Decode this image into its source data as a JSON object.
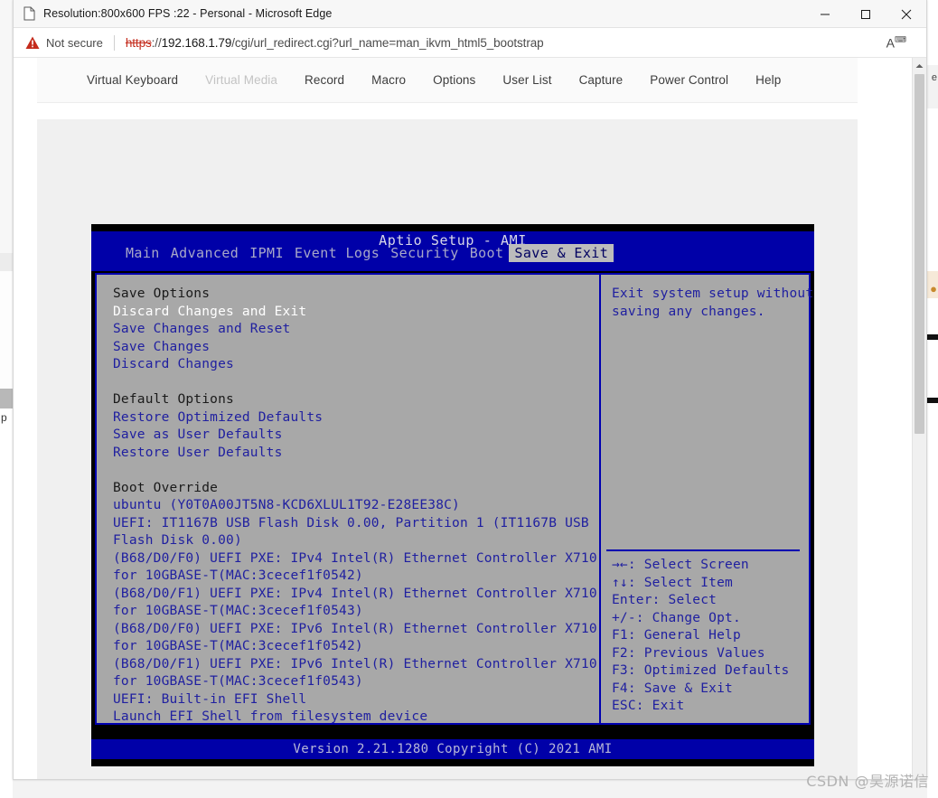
{
  "window": {
    "title": "Resolution:800x600 FPS :22 - Personal - Microsoft Edge",
    "tab_icon": "document-icon",
    "minimize_label": "—",
    "maximize_label": "☐",
    "close_label": "✕"
  },
  "address_bar": {
    "security_icon": "warning-triangle-icon",
    "security_label": "Not secure",
    "url_scheme": "https",
    "url_separator": "://",
    "url_host": "192.168.1.79",
    "url_path": "/cgi/url_redirect.cgi?url_name=man_ikvm_html5_bootstrap",
    "read_aloud_icon": "read-aloud-icon"
  },
  "kvm_toolbar": {
    "items": [
      {
        "label": "Virtual Keyboard",
        "disabled": false
      },
      {
        "label": "Virtual Media",
        "disabled": true
      },
      {
        "label": "Record",
        "disabled": false
      },
      {
        "label": "Macro",
        "disabled": false
      },
      {
        "label": "Options",
        "disabled": false
      },
      {
        "label": "User List",
        "disabled": false
      },
      {
        "label": "Capture",
        "disabled": false
      },
      {
        "label": "Power Control",
        "disabled": false
      },
      {
        "label": "Help",
        "disabled": false
      }
    ]
  },
  "bios": {
    "title": "Aptio Setup - AMI",
    "tabs": [
      {
        "label": "Main",
        "active": false
      },
      {
        "label": "Advanced",
        "active": false
      },
      {
        "label": "IPMI",
        "active": false
      },
      {
        "label": "Event Logs",
        "active": false
      },
      {
        "label": "Security",
        "active": false
      },
      {
        "label": "Boot",
        "active": false
      },
      {
        "label": "Save & Exit",
        "active": true
      }
    ],
    "left_lines": [
      {
        "text": "Save Options",
        "style": "head"
      },
      {
        "text": "Discard Changes and Exit",
        "style": "sel"
      },
      {
        "text": "Save Changes and Reset",
        "style": "item"
      },
      {
        "text": "Save Changes",
        "style": "item"
      },
      {
        "text": "Discard Changes",
        "style": "item"
      },
      {
        "text": " ",
        "style": "blank"
      },
      {
        "text": "Default Options",
        "style": "head"
      },
      {
        "text": "Restore Optimized Defaults",
        "style": "item"
      },
      {
        "text": "Save as User Defaults",
        "style": "item"
      },
      {
        "text": "Restore User Defaults",
        "style": "item"
      },
      {
        "text": " ",
        "style": "blank"
      },
      {
        "text": "Boot Override",
        "style": "head"
      },
      {
        "text": "ubuntu (Y0T0A00JT5N8-KCD6XLUL1T92-E28EE38C)",
        "style": "item"
      },
      {
        "text": "UEFI: IT1167B USB Flash Disk 0.00, Partition 1 (IT1167B USB",
        "style": "item"
      },
      {
        "text": "Flash Disk 0.00)",
        "style": "item"
      },
      {
        "text": "(B68/D0/F0) UEFI PXE: IPv4 Intel(R) Ethernet Controller X710",
        "style": "item"
      },
      {
        "text": "for 10GBASE-T(MAC:3cecef1f0542)",
        "style": "item"
      },
      {
        "text": "(B68/D0/F1) UEFI PXE: IPv4 Intel(R) Ethernet Controller X710",
        "style": "item"
      },
      {
        "text": "for 10GBASE-T(MAC:3cecef1f0543)",
        "style": "item"
      },
      {
        "text": "(B68/D0/F0) UEFI PXE: IPv6 Intel(R) Ethernet Controller X710",
        "style": "item"
      },
      {
        "text": "for 10GBASE-T(MAC:3cecef1f0542)",
        "style": "item"
      },
      {
        "text": "(B68/D0/F1) UEFI PXE: IPv6 Intel(R) Ethernet Controller X710",
        "style": "item"
      },
      {
        "text": "for 10GBASE-T(MAC:3cecef1f0543)",
        "style": "item"
      },
      {
        "text": "UEFI: Built-in EFI Shell",
        "style": "item"
      },
      {
        "text": "Launch EFI Shell from filesystem device",
        "style": "item"
      }
    ],
    "help_text": "Exit system setup without\nsaving any changes.",
    "key_legend": [
      "→←: Select Screen",
      "↑↓: Select Item",
      "Enter: Select",
      "+/-: Change Opt.",
      "F1: General Help",
      "F2: Previous Values",
      "F3: Optimized Defaults",
      "F4: Save & Exit",
      "ESC: Exit"
    ],
    "version": "Version 2.21.1280 Copyright (C) 2021 AMI"
  },
  "kbd_button": {
    "icon": "keyboard-icon"
  },
  "scrollbar": {
    "up_arrow_icon": "chevron-up-icon"
  },
  "watermark": {
    "text": "CSDN @昊源诺信"
  },
  "colors": {
    "bios_blue_bg": "#0000a8",
    "bios_panel_gray": "#a8a8a8",
    "bios_text_blue": "#2020a0",
    "bios_tab_active_bg": "#bcbcbc",
    "warning_red": "#c42b1c"
  }
}
